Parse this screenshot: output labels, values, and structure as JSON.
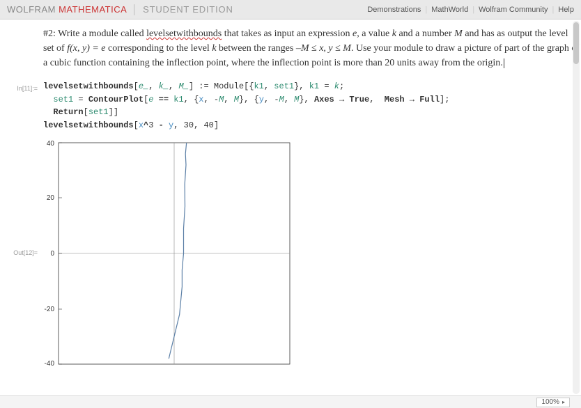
{
  "topbar": {
    "brand_w1": "WOLFRAM",
    "brand_w2": "MATHEMATICA",
    "brand_w3": "STUDENT EDITION",
    "links": {
      "demos": "Demonstrations",
      "mathworld": "MathWorld",
      "community": "Wolfram Community",
      "help": "Help"
    }
  },
  "problem": {
    "prefix": "#2: Write a module called ",
    "modname": "levelsetwithbounds",
    "mid1": " that takes as input an expression ",
    "e": "e",
    "mid2": ", a value ",
    "k": "k",
    "mid3": " and a number ",
    "M": "M",
    "mid4": " and has as output the level set of ",
    "fxy": "f(x, y) = e",
    "mid5": " corresponding to the level ",
    "k2": "k",
    "mid6": " between the ranges ",
    "range": "–M ≤  x,  y ≤ M",
    "mid7": ". Use your module to draw a picture of part of the graph of a cubic function containing the inflection point, where the inflection point is more than 20 units away from the origin."
  },
  "code": {
    "in_label": "In[11]:=",
    "out_label": "Out[12]=",
    "l1_a": "levelsetwithbounds",
    "l1_b": "[",
    "l1_e": "e_",
    "l1_c1": ", ",
    "l1_k": "k_",
    "l1_c2": ", ",
    "l1_M": "M_",
    "l1_d": "] := Module[{",
    "l1_k1": "k1",
    "l1_c3": ", ",
    "l1_s1": "set1",
    "l1_e1": "}, ",
    "l1_k1b": "k1",
    "l1_eq": " = ",
    "l1_ks": "k",
    "l1_end": ";",
    "l2_a": "  ",
    "l2_s1": "set1",
    "l2_eq": " = ",
    "l2_cp": "ContourPlot",
    "l2_b": "[",
    "l2_e": "e",
    "l2_eqeq": " == ",
    "l2_k1": "k1",
    "l2_c": ", {",
    "l2_x": "x",
    "l2_c2": ", -",
    "l2_M1": "M",
    "l2_c3": ", ",
    "l2_M2": "M",
    "l2_c4": "}, {",
    "l2_y": "y",
    "l2_c5": ", -",
    "l2_M3": "M",
    "l2_c6": ", ",
    "l2_M4": "M",
    "l2_c7": "}, ",
    "l2_ax": "Axes",
    "l2_ar1": " → ",
    "l2_tr": "True",
    "l2_c8": ",  ",
    "l2_mesh": "Mesh",
    "l2_ar2": " → ",
    "l2_full": "Full",
    "l2_end": "];",
    "l3_a": "  ",
    "l3_ret": "Return",
    "l3_b": "[",
    "l3_s1": "set1",
    "l3_c": "]]",
    "l4_a": "levelsetwithbounds",
    "l4_b": "[",
    "l4_x": "x",
    "l4_pow": "^",
    "l4_3": "3",
    "l4_m": " - ",
    "l4_y": "y",
    "l4_c": ", ",
    "l4_30": "30",
    "l4_c2": ", ",
    "l4_40": "40",
    "l4_end": "]"
  },
  "chart_data": {
    "type": "line",
    "title": "",
    "xlabel": "",
    "ylabel": "",
    "xlim": [
      -40,
      40
    ],
    "ylim": [
      -40,
      40
    ],
    "y_ticks": [
      -40,
      -20,
      0,
      20,
      40
    ],
    "series": [
      {
        "name": "x^3 - y = 30",
        "x": [
          -2.0,
          2.0,
          2.6,
          2.9,
          3.1,
          3.4,
          3.6,
          3.8,
          3.95,
          4.05,
          4.12
        ],
        "y": [
          -38,
          -22,
          -12,
          -6,
          0,
          9,
          17,
          25,
          32,
          36,
          40
        ]
      }
    ]
  },
  "status": {
    "zoom": "100%"
  }
}
